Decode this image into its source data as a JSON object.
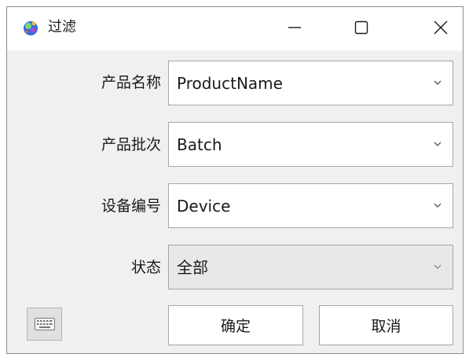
{
  "window": {
    "title": "过滤",
    "controls": {
      "minimize": "minimize-icon",
      "maximize": "maximize-icon",
      "close": "close-icon"
    }
  },
  "form": {
    "rows": [
      {
        "label": "产品名称",
        "value": "ProductName"
      },
      {
        "label": "产品批次",
        "value": "Batch"
      },
      {
        "label": "设备编号",
        "value": "Device"
      },
      {
        "label": "状态",
        "value": "全部"
      }
    ]
  },
  "actions": {
    "keyboard_icon": "keyboard-icon",
    "ok_label": "确定",
    "cancel_label": "取消"
  },
  "colors": {
    "window_bg": "#f0f0f0",
    "titlebar_bg": "#ffffff",
    "border": "#a6a6a6",
    "text": "#1a1a1a"
  }
}
